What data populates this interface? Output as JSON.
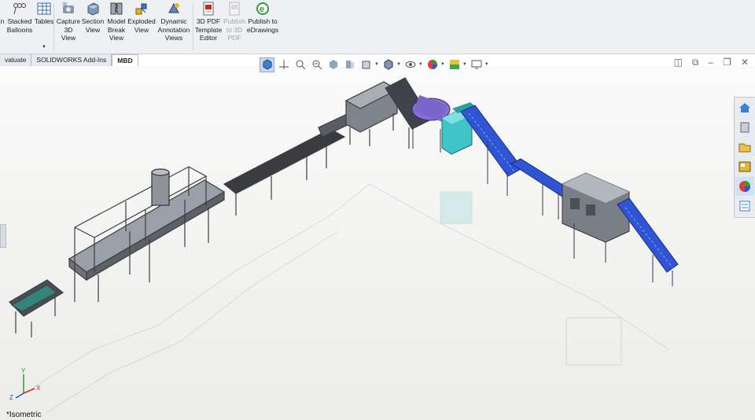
{
  "ribbon": {
    "buttons": [
      {
        "name": "partial-button-n",
        "label": "n",
        "icon": "cut-icon",
        "enabled": true
      },
      {
        "name": "stacked-balloons-button",
        "label": "Stacked Balloons",
        "icon": "stacked-balloons-icon",
        "enabled": true
      },
      {
        "name": "tables-button",
        "label": "Tables",
        "icon": "table-icon",
        "enabled": true
      },
      {
        "name": "capture-3d-view-button",
        "label": "Capture 3D View",
        "icon": "camera-3d-icon",
        "enabled": true
      },
      {
        "name": "section-view-button",
        "label": "Section View",
        "icon": "section-view-icon",
        "enabled": true
      },
      {
        "name": "model-break-view-button",
        "label": "Model Break View",
        "icon": "model-break-icon",
        "enabled": true
      },
      {
        "name": "exploded-view-button",
        "label": "Exploded View",
        "icon": "exploded-view-icon",
        "enabled": true
      },
      {
        "name": "dynamic-annotation-views-button",
        "label": "Dynamic Annotation Views",
        "icon": "dynamic-annotation-icon",
        "enabled": true
      },
      {
        "name": "3d-pdf-template-editor-button",
        "label": "3D PDF Template Editor",
        "icon": "pdf-template-icon",
        "enabled": true
      },
      {
        "name": "publish-to-3d-pdf-button",
        "label": "Publish to 3D PDF",
        "icon": "publish-pdf-icon",
        "enabled": false
      },
      {
        "name": "publish-to-edrawings-button",
        "label": "Publish to eDrawings",
        "icon": "edrawings-icon",
        "enabled": true
      }
    ]
  },
  "tabs": [
    {
      "label": "valuate",
      "active": false
    },
    {
      "label": "SOLIDWORKS Add-Ins",
      "active": false
    },
    {
      "label": "MBD",
      "active": true
    }
  ],
  "viewport": {
    "view_label": "*Isometric",
    "triad": {
      "x": "X",
      "y": "Y",
      "z": "Z"
    }
  },
  "heads_up_toolbar": [
    "view-orientation-icon",
    "zoom-fit-icon",
    "zoom-area-icon",
    "previous-view-icon",
    "section-view-icon",
    "dynamic-annotation-icon",
    "view-orientation-cube-icon",
    "display-style-icon",
    "hide-show-icon",
    "edit-appearance-icon",
    "apply-scene-icon",
    "view-settings-icon"
  ],
  "task_pane": [
    "home-icon",
    "design-library-icon",
    "file-explorer-icon",
    "view-palette-icon",
    "appearances-icon",
    "custom-properties-icon"
  ],
  "colors": {
    "accent_blue": "#2f55d4",
    "teal": "#3fc4c7",
    "frame": "#3b3d42",
    "ribbon_bg": "#eef0f3"
  }
}
